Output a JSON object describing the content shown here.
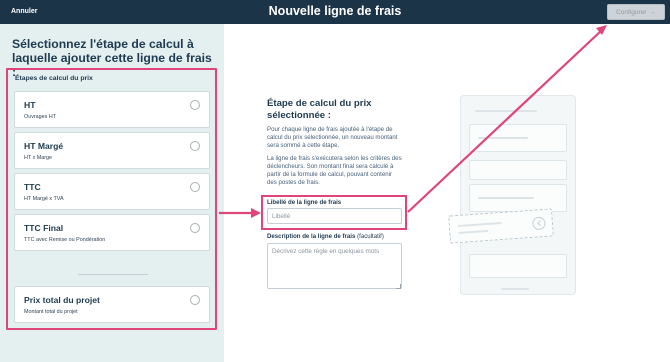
{
  "topbar": {
    "cancel_label": "Annuler",
    "title": "Nouvelle ligne de frais",
    "configure_label": "Configurer",
    "configure_arrow": "→"
  },
  "left_panel": {
    "heading": "Sélectionnez l'étape de calcul à laquelle ajouter cette ligne de frais :",
    "steps_label": "Étapes de calcul du prix",
    "steps": [
      {
        "title": "HT",
        "subtitle": "Ouvrages HT"
      },
      {
        "title": "HT Margé",
        "subtitle": "HT x Marge"
      },
      {
        "title": "TTC",
        "subtitle": "HT Margé x TVA"
      },
      {
        "title": "TTC Final",
        "subtitle": "TTC avec Remise ou Pondération"
      },
      {
        "title": "Prix total du projet",
        "subtitle": "Montant total du projet"
      }
    ]
  },
  "form": {
    "heading": "Étape de calcul du prix sélectionnée :",
    "paragraph_1": "Pour chaque ligne de frais ajoutée à l'étape de calcul du prix sélectionnée, un nouveau montant sera sommé à cette étape.",
    "paragraph_2": "La ligne de frais s'exécutera selon les critères des déclencheurs. Son montant final sera calculé à partir de la formule de calcul, pouvant contenir des postes de frais.",
    "label_field": {
      "label": "Libellé de la ligne de frais",
      "placeholder": "Libellé",
      "value": ""
    },
    "description_field": {
      "label": "Description de la ligne de frais",
      "optional": "(facultatif)",
      "placeholder": "Décrivez cette règle en quelques mots",
      "value": ""
    }
  },
  "colors": {
    "topbar": "#1c3448",
    "left_panel": "#e4eff0",
    "highlight": "#e0457a",
    "text_dark": "#1e3b4f"
  },
  "icons": [
    "arrow-right-icon",
    "radio-icon",
    "annotation-arrow-icon"
  ]
}
